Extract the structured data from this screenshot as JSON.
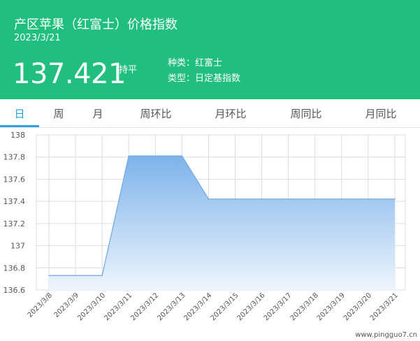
{
  "header": {
    "title": "产区苹果（红富士）价格指数",
    "date": "2023/3/21",
    "price": "137.421",
    "trend": "持平",
    "meta_variety": "种类：红富士",
    "meta_type": "类型：日定基指数"
  },
  "tabs": [
    {
      "label": "日",
      "active": true
    },
    {
      "label": "周",
      "active": false
    },
    {
      "label": "月",
      "active": false
    },
    {
      "label": "周环比",
      "active": false
    },
    {
      "label": "月环比",
      "active": false
    },
    {
      "label": "周同比",
      "active": false
    },
    {
      "label": "月同比",
      "active": false
    }
  ],
  "chart_data": {
    "type": "area",
    "x": [
      "2023/3/8",
      "2023/3/9",
      "2023/3/10",
      "2023/3/11",
      "2023/3/12",
      "2023/3/13",
      "2023/3/14",
      "2023/3/15",
      "2023/3/16",
      "2023/3/17",
      "2023/3/18",
      "2023/3/19",
      "2023/3/20",
      "2023/3/21"
    ],
    "series": [
      {
        "values": [
          136.73,
          136.73,
          136.73,
          137.81,
          137.81,
          137.81,
          137.421,
          137.421,
          137.421,
          137.421,
          137.421,
          137.421,
          137.421,
          137.421
        ]
      }
    ],
    "yticks": [
      "138",
      "137.8",
      "137.6",
      "137.4",
      "137.2",
      "137",
      "136.8",
      "136.6"
    ],
    "ylim": [
      136.6,
      138
    ],
    "grid": true,
    "colors": {
      "area_top": "#7db3ea",
      "area_bottom": "#eef5fd",
      "line": "#6fa8e6",
      "grid": "#d9dde3"
    }
  },
  "watermark": "www.pingguo7.cn"
}
